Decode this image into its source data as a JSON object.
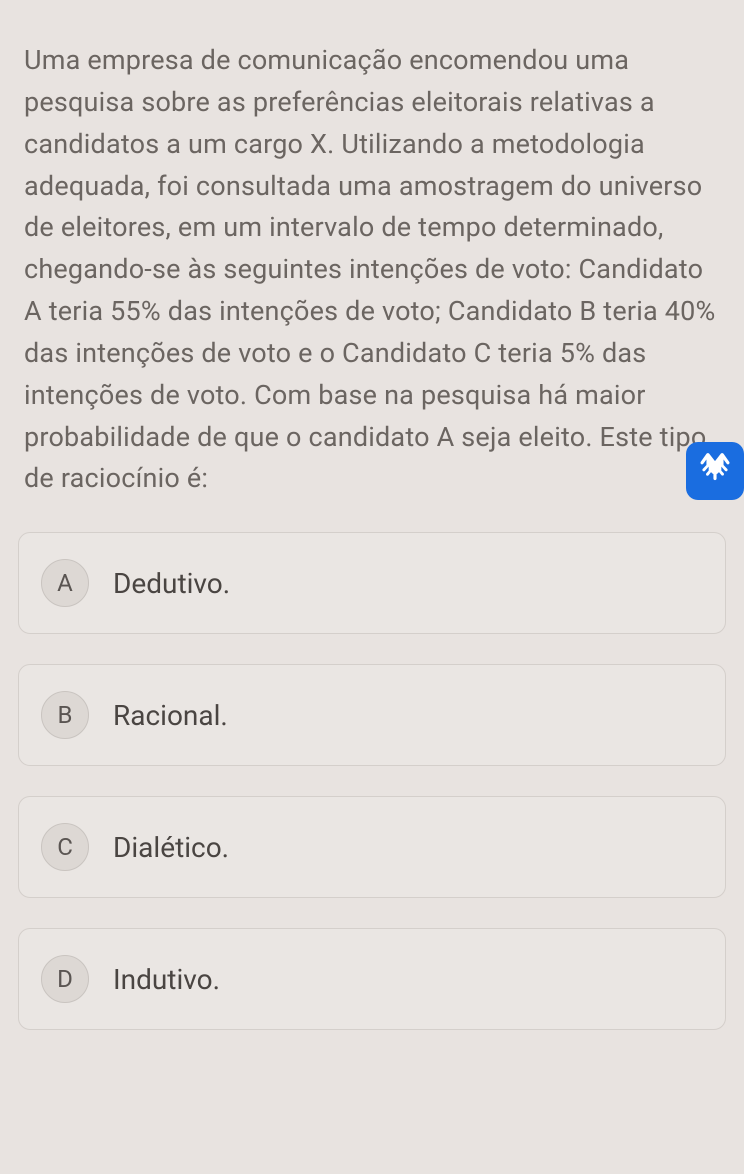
{
  "question": {
    "text": "Uma empresa de comunicação encomendou uma pesquisa sobre as preferências eleitorais relativas a candidatos a um cargo X. Utilizando a metodologia adequada, foi consultada uma amostragem do universo de eleitores, em um intervalo de tempo determinado, chegando-se às seguintes intenções de voto: Candidato A teria 55% das intenções de voto; Candidato B teria 40% das intenções de voto e o Candidato C teria 5% das intenções de voto. Com base na pesquisa há maior probabilidade de que o candidato A seja eleito. Este tipo de raciocínio é:"
  },
  "options": [
    {
      "letter": "A",
      "label": "Dedutivo."
    },
    {
      "letter": "B",
      "label": "Racional."
    },
    {
      "letter": "C",
      "label": "Dialético."
    },
    {
      "letter": "D",
      "label": "Indutivo."
    }
  ],
  "accessibility": {
    "label": "accessibility"
  }
}
